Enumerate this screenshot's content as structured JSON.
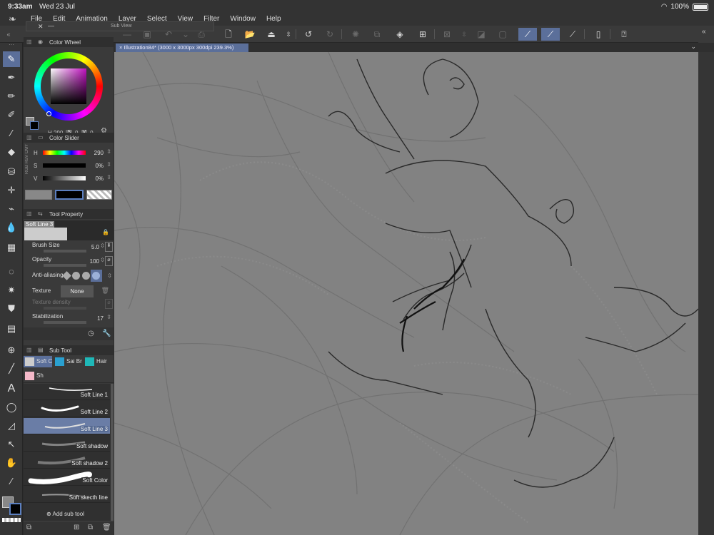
{
  "status": {
    "time": "9:33am",
    "date": "Wed 23 Jul",
    "battery": "100%",
    "battery_level": 1.0
  },
  "menu": {
    "items": [
      "File",
      "Edit",
      "Animation",
      "Layer",
      "Select",
      "View",
      "Filter",
      "Window",
      "Help"
    ]
  },
  "subview": {
    "title": "Sub View"
  },
  "canvas_tab": {
    "title": "Illustration84* (3000 x 3000px 300dpi 239.3%)"
  },
  "color_wheel": {
    "title": "Color Wheel",
    "h": "290",
    "s": "0",
    "v": "0",
    "h_label": "H",
    "s_label": "S",
    "v_label": "V"
  },
  "color_slider": {
    "title": "Color Slider",
    "side_tabs": "RGB HSV CMY",
    "rows": [
      {
        "label": "H",
        "value": "290"
      },
      {
        "label": "S",
        "value": "0%"
      },
      {
        "label": "V",
        "value": "0%"
      }
    ]
  },
  "tool_property": {
    "title": "Tool Property",
    "preview_label": "Soft Line 3",
    "brush_size": {
      "label": "Brush Size",
      "value": "5.0"
    },
    "opacity": {
      "label": "Opacity",
      "value": "100"
    },
    "anti_aliasing": {
      "label": "Anti-aliasing"
    },
    "texture": {
      "label": "Texture",
      "value": "None"
    },
    "texture_density": {
      "label": "Texture density"
    },
    "stabilization": {
      "label": "Stabilization",
      "value": "17"
    }
  },
  "sub_tool": {
    "title": "Sub Tool",
    "tabs": [
      "Soft C",
      "Sai Br",
      "Hair"
    ],
    "tab2": "Sh",
    "items": [
      "Soft Line 1",
      "Soft Line 2",
      "Soft Line 3",
      "Soft shadow",
      "Soft shadow 2",
      "Soft Color",
      "Soft skecth line"
    ],
    "selected_index": 2,
    "add_label": "Add sub tool"
  },
  "colors": {
    "accent": "#5b6f9a",
    "canvas": "#828282",
    "panel": "#3a3a3a"
  }
}
